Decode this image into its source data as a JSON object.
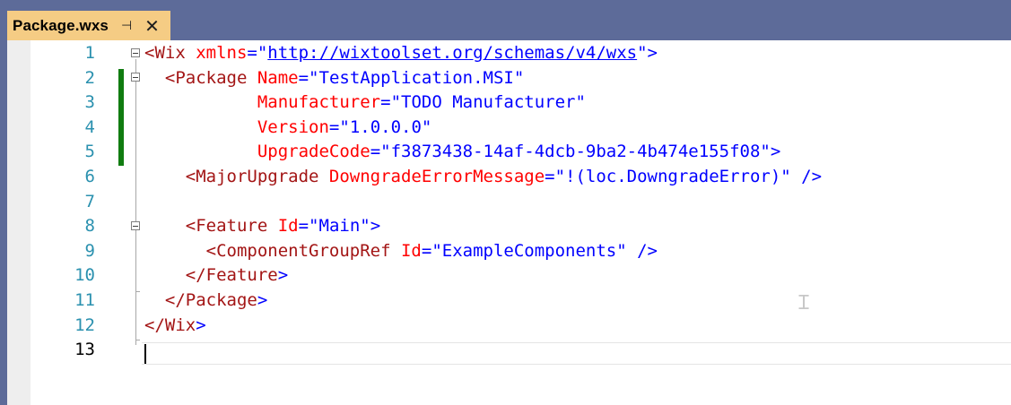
{
  "tab": {
    "title": "Package.wxs",
    "pin_icon": "⊣",
    "close_icon": "✕"
  },
  "editor": {
    "current_line": 13,
    "lines": [
      {
        "num": "1",
        "parts": [
          [
            "el",
            "<Wix"
          ],
          [
            "at",
            " xmlns"
          ],
          [
            "pun",
            "=\""
          ],
          [
            "url",
            "http://wixtoolset.org/schemas/v4/wxs"
          ],
          [
            "pun",
            "\">"
          ]
        ]
      },
      {
        "num": "2",
        "parts": [
          [
            "txt",
            "  "
          ],
          [
            "el",
            "<Package"
          ],
          [
            "at",
            " Name"
          ],
          [
            "pun",
            "=\""
          ],
          [
            "val",
            "TestApplication.MSI"
          ],
          [
            "pun",
            "\""
          ]
        ]
      },
      {
        "num": "3",
        "parts": [
          [
            "txt",
            "           "
          ],
          [
            "at",
            "Manufacturer"
          ],
          [
            "pun",
            "=\""
          ],
          [
            "val",
            "TODO Manufacturer"
          ],
          [
            "pun",
            "\""
          ]
        ]
      },
      {
        "num": "4",
        "parts": [
          [
            "txt",
            "           "
          ],
          [
            "at",
            "Version"
          ],
          [
            "pun",
            "=\""
          ],
          [
            "val",
            "1.0.0.0"
          ],
          [
            "pun",
            "\""
          ]
        ]
      },
      {
        "num": "5",
        "parts": [
          [
            "txt",
            "           "
          ],
          [
            "at",
            "UpgradeCode"
          ],
          [
            "pun",
            "=\""
          ],
          [
            "val",
            "f3873438-14af-4dcb-9ba2-4b474e155f08"
          ],
          [
            "pun",
            "\">"
          ]
        ]
      },
      {
        "num": "6",
        "parts": [
          [
            "txt",
            "    "
          ],
          [
            "el",
            "<MajorUpgrade"
          ],
          [
            "at",
            " DowngradeErrorMessage"
          ],
          [
            "pun",
            "=\""
          ],
          [
            "val",
            "!(loc.DowngradeError)"
          ],
          [
            "pun",
            "\" />"
          ]
        ]
      },
      {
        "num": "7",
        "parts": []
      },
      {
        "num": "8",
        "parts": [
          [
            "txt",
            "    "
          ],
          [
            "el",
            "<Feature"
          ],
          [
            "at",
            " Id"
          ],
          [
            "pun",
            "=\""
          ],
          [
            "val",
            "Main"
          ],
          [
            "pun",
            "\">"
          ]
        ]
      },
      {
        "num": "9",
        "parts": [
          [
            "txt",
            "      "
          ],
          [
            "el",
            "<ComponentGroupRef"
          ],
          [
            "at",
            " Id"
          ],
          [
            "pun",
            "=\""
          ],
          [
            "val",
            "ExampleComponents"
          ],
          [
            "pun",
            "\" />"
          ]
        ]
      },
      {
        "num": "10",
        "parts": [
          [
            "txt",
            "    "
          ],
          [
            "el",
            "</Feature"
          ],
          [
            "pun",
            ">"
          ]
        ]
      },
      {
        "num": "11",
        "parts": [
          [
            "txt",
            "  "
          ],
          [
            "el",
            "</Package"
          ],
          [
            "pun",
            ">"
          ]
        ]
      },
      {
        "num": "12",
        "parts": [
          [
            "el",
            "</Wix"
          ],
          [
            "pun",
            ">"
          ]
        ]
      },
      {
        "num": "13",
        "parts": []
      }
    ]
  }
}
